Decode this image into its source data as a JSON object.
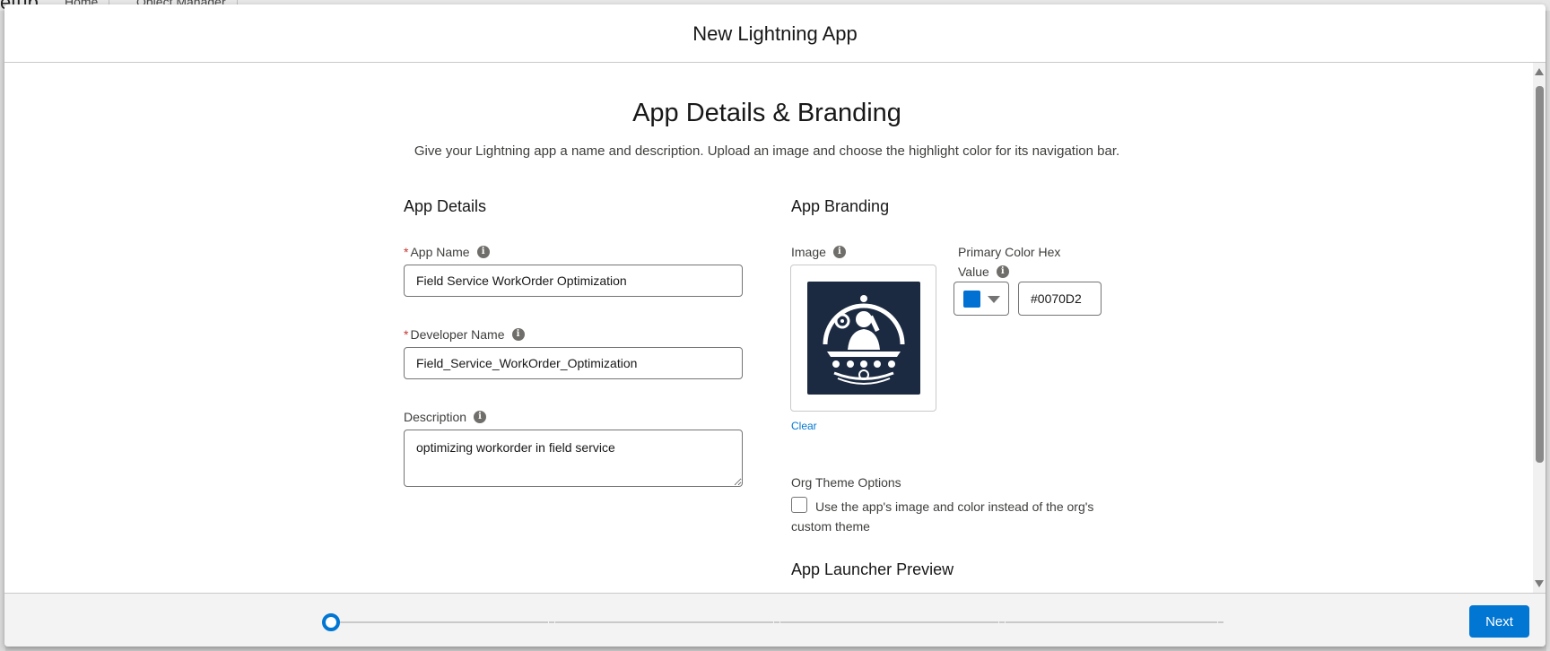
{
  "background": {
    "setup_title": "etup",
    "tabs": [
      "Home",
      "Object Manager"
    ]
  },
  "modal": {
    "title": "New Lightning App"
  },
  "page": {
    "heading": "App Details & Branding",
    "subheading": "Give your Lightning app a name and description. Upload an image and choose the highlight color for its navigation bar."
  },
  "app_details": {
    "section_title": "App Details",
    "app_name": {
      "label": "App Name",
      "required": "*",
      "value": "Field Service WorkOrder Optimization"
    },
    "developer_name": {
      "label": "Developer Name",
      "required": "*",
      "value": "Field_Service_WorkOrder_Optimization"
    },
    "description": {
      "label": "Description",
      "value": "optimizing workorder in field service"
    }
  },
  "app_branding": {
    "section_title": "App Branding",
    "image_label": "Image",
    "clear_label": "Clear",
    "primary_color_label_line1": "Primary Color Hex",
    "primary_color_label_line2": "Value",
    "primary_color_value": "#0070D2",
    "primary_color": "#0070D2",
    "org_theme_title": "Org Theme Options",
    "org_theme_checkbox_label": "Use the app's image and color instead of the org's custom theme",
    "org_theme_checked": false,
    "launcher_preview_title": "App Launcher Preview"
  },
  "footer": {
    "next_label": "Next",
    "progress_steps": 5,
    "current_step": 1
  },
  "colors": {
    "brand_blue": "#0176D3",
    "logo_background": "#1B2A41"
  }
}
